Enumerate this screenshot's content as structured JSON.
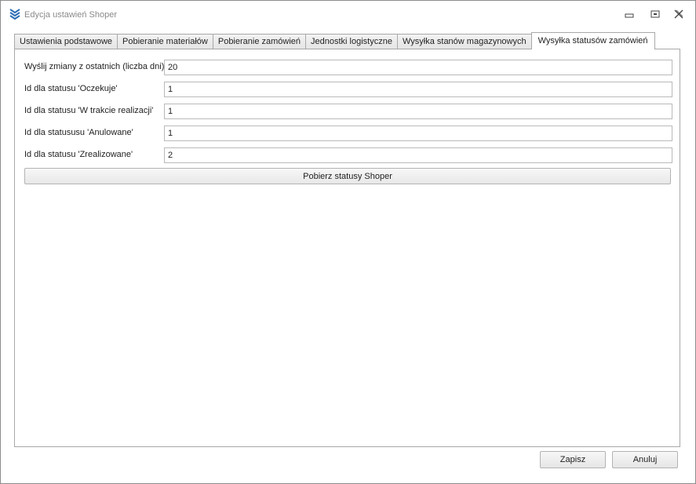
{
  "window": {
    "title": "Edycja ustawień Shoper",
    "icon": "chevrons-down-icon",
    "controls": [
      "minimize-icon",
      "restore-icon",
      "close-icon"
    ]
  },
  "tabs": [
    {
      "label": "Ustawienia podstawowe",
      "active": false
    },
    {
      "label": "Pobieranie materiałów",
      "active": false
    },
    {
      "label": "Pobieranie zamówień",
      "active": false
    },
    {
      "label": "Jednostki logistyczne",
      "active": false
    },
    {
      "label": "Wysyłka stanów magazynowych",
      "active": false
    },
    {
      "label": "Wysyłka statusów zamówień",
      "active": true
    }
  ],
  "form": {
    "fields": [
      {
        "label": "Wyślij zmiany z ostatnich (liczba dni)",
        "value": "20"
      },
      {
        "label": "Id dla statusu 'Oczekuje'",
        "value": "1"
      },
      {
        "label": "Id dla statusu 'W trakcie realizacji'",
        "value": "1"
      },
      {
        "label": "Id dla statususu 'Anulowane'",
        "value": "1"
      },
      {
        "label": "Id dla statusu 'Zrealizowane'",
        "value": "2"
      }
    ],
    "fetch_button": "Pobierz statusy Shoper"
  },
  "footer": {
    "save_label": "Zapisz",
    "cancel_label": "Anuluj"
  },
  "colors": {
    "icon_blue": "#2f6fb5",
    "border": "#a8a8a8"
  }
}
